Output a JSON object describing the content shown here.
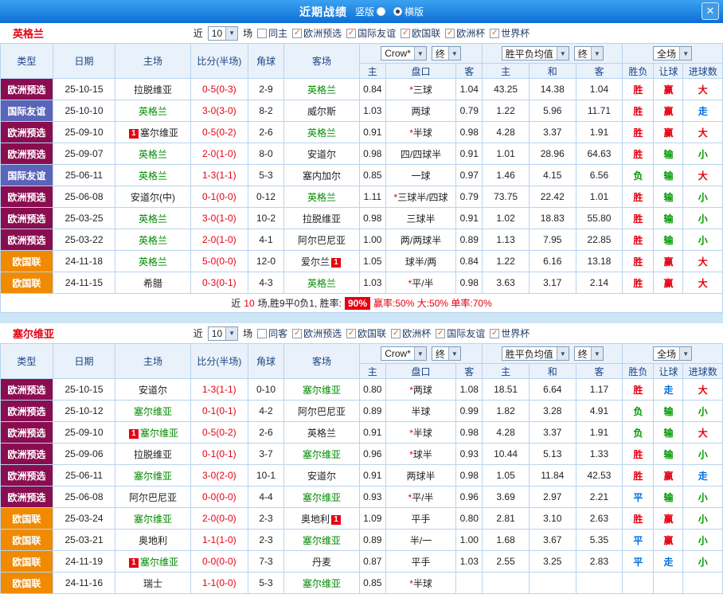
{
  "colors": {
    "type_欧洲预选": "#8a0d50",
    "type_国际友谊": "#5a64b8",
    "type_欧国联": "#f08a00",
    "result_win_red": "#e60012",
    "result_lose_green": "#009900",
    "result_push_blue": "#0070dd",
    "team_green": "#008a00",
    "score_red": "#e60012",
    "titlebar_blue": "#0d6ed6"
  },
  "titlebar": {
    "title": "近期战绩",
    "radios": [
      {
        "label": "竖版",
        "selected": false
      },
      {
        "label": "横版",
        "selected": true
      }
    ],
    "close_glyph": "✕"
  },
  "table_header": {
    "fixed_cols": [
      "类型",
      "日期",
      "主场",
      "比分(半场)",
      "角球",
      "客场"
    ],
    "groups": [
      {
        "dropdowns": [
          "Crow*",
          "终"
        ],
        "sub": [
          "主",
          "盘口",
          "客"
        ]
      },
      {
        "dropdowns": [
          "胜平负均值",
          "终"
        ],
        "sub": [
          "主",
          "和",
          "客"
        ]
      },
      {
        "dropdowns": [
          "全场"
        ],
        "sub": [
          "胜负",
          "让球",
          "进球数"
        ]
      }
    ]
  },
  "sections": [
    {
      "team": "英格兰",
      "filter": {
        "near_label": "近",
        "count": "10",
        "games_label": "场",
        "checkboxes": [
          {
            "label": "同主",
            "checked": false
          },
          {
            "label": "欧洲预选",
            "checked": true
          },
          {
            "label": "国际友谊",
            "checked": true
          },
          {
            "label": "欧国联",
            "checked": true
          },
          {
            "label": "欧洲杯",
            "checked": true
          },
          {
            "label": "世界杯",
            "checked": true
          }
        ]
      },
      "rows": [
        {
          "type": "欧洲预选",
          "date": "25-10-15",
          "home": "拉脱维亚",
          "home_green": false,
          "home_badge": "",
          "score": "0-5(0-3)",
          "corner": "2-9",
          "away": "英格兰",
          "away_green": true,
          "away_badge": "",
          "o1": "0.84",
          "handicap": "*三球",
          "o2": "1.04",
          "m1": "43.25",
          "m2": "14.38",
          "m3": "1.04",
          "r1": "胜",
          "r2": "赢",
          "r3": "大"
        },
        {
          "type": "国际友谊",
          "date": "25-10-10",
          "home": "英格兰",
          "home_green": true,
          "home_badge": "",
          "score": "3-0(3-0)",
          "corner": "8-2",
          "away": "威尔斯",
          "away_green": false,
          "away_badge": "",
          "o1": "1.03",
          "handicap": "两球",
          "o2": "0.79",
          "m1": "1.22",
          "m2": "5.96",
          "m3": "11.71",
          "r1": "胜",
          "r2": "赢",
          "r3": "走"
        },
        {
          "type": "欧洲预选",
          "date": "25-09-10",
          "home": "塞尔维亚",
          "home_green": false,
          "home_badge": "1",
          "score": "0-5(0-2)",
          "corner": "2-6",
          "away": "英格兰",
          "away_green": true,
          "away_badge": "",
          "o1": "0.91",
          "handicap": "*半球",
          "o2": "0.98",
          "m1": "4.28",
          "m2": "3.37",
          "m3": "1.91",
          "r1": "胜",
          "r2": "赢",
          "r3": "大"
        },
        {
          "type": "欧洲预选",
          "date": "25-09-07",
          "home": "英格兰",
          "home_green": true,
          "home_badge": "",
          "score": "2-0(1-0)",
          "corner": "8-0",
          "away": "安道尔",
          "away_green": false,
          "away_badge": "",
          "o1": "0.98",
          "handicap": "四/四球半",
          "o2": "0.91",
          "m1": "1.01",
          "m2": "28.96",
          "m3": "64.63",
          "r1": "胜",
          "r2": "输",
          "r3": "小"
        },
        {
          "type": "国际友谊",
          "date": "25-06-11",
          "home": "英格兰",
          "home_green": true,
          "home_badge": "",
          "score": "1-3(1-1)",
          "corner": "5-3",
          "away": "塞内加尔",
          "away_green": false,
          "away_badge": "",
          "o1": "0.85",
          "handicap": "一球",
          "o2": "0.97",
          "m1": "1.46",
          "m2": "4.15",
          "m3": "6.56",
          "r1": "负",
          "r2": "输",
          "r3": "大"
        },
        {
          "type": "欧洲预选",
          "date": "25-06-08",
          "home": "安道尔(中)",
          "home_green": false,
          "home_badge": "",
          "score": "0-1(0-0)",
          "corner": "0-12",
          "away": "英格兰",
          "away_green": true,
          "away_badge": "",
          "o1": "1.11",
          "handicap": "*三球半/四球",
          "o2": "0.79",
          "m1": "73.75",
          "m2": "22.42",
          "m3": "1.01",
          "r1": "胜",
          "r2": "输",
          "r3": "小"
        },
        {
          "type": "欧洲预选",
          "date": "25-03-25",
          "home": "英格兰",
          "home_green": true,
          "home_badge": "",
          "score": "3-0(1-0)",
          "corner": "10-2",
          "away": "拉脱维亚",
          "away_green": false,
          "away_badge": "",
          "o1": "0.98",
          "handicap": "三球半",
          "o2": "0.91",
          "m1": "1.02",
          "m2": "18.83",
          "m3": "55.80",
          "r1": "胜",
          "r2": "输",
          "r3": "小"
        },
        {
          "type": "欧洲预选",
          "date": "25-03-22",
          "home": "英格兰",
          "home_green": true,
          "home_badge": "",
          "score": "2-0(1-0)",
          "corner": "4-1",
          "away": "阿尔巴尼亚",
          "away_green": false,
          "away_badge": "",
          "o1": "1.00",
          "handicap": "两/两球半",
          "o2": "0.89",
          "m1": "1.13",
          "m2": "7.95",
          "m3": "22.85",
          "r1": "胜",
          "r2": "输",
          "r3": "小"
        },
        {
          "type": "欧国联",
          "date": "24-11-18",
          "home": "英格兰",
          "home_green": true,
          "home_badge": "",
          "score": "5-0(0-0)",
          "corner": "12-0",
          "away": "爱尔兰",
          "away_green": false,
          "away_badge": "1",
          "o1": "1.05",
          "handicap": "球半/两",
          "o2": "0.84",
          "m1": "1.22",
          "m2": "6.16",
          "m3": "13.18",
          "r1": "胜",
          "r2": "赢",
          "r3": "大"
        },
        {
          "type": "欧国联",
          "date": "24-11-15",
          "home": "希腊",
          "home_green": false,
          "home_badge": "",
          "score": "0-3(0-1)",
          "corner": "4-3",
          "away": "英格兰",
          "away_green": true,
          "away_badge": "",
          "o1": "1.03",
          "handicap": "*平/半",
          "o2": "0.98",
          "m1": "3.63",
          "m2": "3.17",
          "m3": "2.14",
          "r1": "胜",
          "r2": "赢",
          "r3": "大"
        }
      ],
      "summary": {
        "seg1": "近",
        "seg2": "10",
        "seg3": "场,胜9平0负1, 胜率:",
        "badge": "90%",
        "seg4": "赢率:50% 大:50% 单率:70%"
      }
    },
    {
      "team": "塞尔维亚",
      "filter": {
        "near_label": "近",
        "count": "10",
        "games_label": "场",
        "checkboxes": [
          {
            "label": "同客",
            "checked": false
          },
          {
            "label": "欧洲预选",
            "checked": true
          },
          {
            "label": "欧国联",
            "checked": true
          },
          {
            "label": "欧洲杯",
            "checked": true
          },
          {
            "label": "国际友谊",
            "checked": true
          },
          {
            "label": "世界杯",
            "checked": true
          }
        ]
      },
      "rows": [
        {
          "type": "欧洲预选",
          "date": "25-10-15",
          "home": "安道尔",
          "home_green": false,
          "home_badge": "",
          "score": "1-3(1-1)",
          "corner": "0-10",
          "away": "塞尔维亚",
          "away_green": true,
          "away_badge": "",
          "o1": "0.80",
          "handicap": "*两球",
          "o2": "1.08",
          "m1": "18.51",
          "m2": "6.64",
          "m3": "1.17",
          "r1": "胜",
          "r2": "走",
          "r3": "大"
        },
        {
          "type": "欧洲预选",
          "date": "25-10-12",
          "home": "塞尔维亚",
          "home_green": true,
          "home_badge": "",
          "score": "0-1(0-1)",
          "corner": "4-2",
          "away": "阿尔巴尼亚",
          "away_green": false,
          "away_badge": "",
          "o1": "0.89",
          "handicap": "半球",
          "o2": "0.99",
          "m1": "1.82",
          "m2": "3.28",
          "m3": "4.91",
          "r1": "负",
          "r2": "输",
          "r3": "小"
        },
        {
          "type": "欧洲预选",
          "date": "25-09-10",
          "home": "塞尔维亚",
          "home_green": true,
          "home_badge": "1",
          "score": "0-5(0-2)",
          "corner": "2-6",
          "away": "英格兰",
          "away_green": false,
          "away_badge": "",
          "o1": "0.91",
          "handicap": "*半球",
          "o2": "0.98",
          "m1": "4.28",
          "m2": "3.37",
          "m3": "1.91",
          "r1": "负",
          "r2": "输",
          "r3": "大"
        },
        {
          "type": "欧洲预选",
          "date": "25-09-06",
          "home": "拉脱维亚",
          "home_green": false,
          "home_badge": "",
          "score": "0-1(0-1)",
          "corner": "3-7",
          "away": "塞尔维亚",
          "away_green": true,
          "away_badge": "",
          "o1": "0.96",
          "handicap": "*球半",
          "o2": "0.93",
          "m1": "10.44",
          "m2": "5.13",
          "m3": "1.33",
          "r1": "胜",
          "r2": "输",
          "r3": "小"
        },
        {
          "type": "欧洲预选",
          "date": "25-06-11",
          "home": "塞尔维亚",
          "home_green": true,
          "home_badge": "",
          "score": "3-0(2-0)",
          "corner": "10-1",
          "away": "安道尔",
          "away_green": false,
          "away_badge": "",
          "o1": "0.91",
          "handicap": "两球半",
          "o2": "0.98",
          "m1": "1.05",
          "m2": "11.84",
          "m3": "42.53",
          "r1": "胜",
          "r2": "赢",
          "r3": "走"
        },
        {
          "type": "欧洲预选",
          "date": "25-06-08",
          "home": "阿尔巴尼亚",
          "home_green": false,
          "home_badge": "",
          "score": "0-0(0-0)",
          "corner": "4-4",
          "away": "塞尔维亚",
          "away_green": true,
          "away_badge": "",
          "o1": "0.93",
          "handicap": "*平/半",
          "o2": "0.96",
          "m1": "3.69",
          "m2": "2.97",
          "m3": "2.21",
          "r1": "平",
          "r2": "输",
          "r3": "小"
        },
        {
          "type": "欧国联",
          "date": "25-03-24",
          "home": "塞尔维亚",
          "home_green": true,
          "home_badge": "",
          "score": "2-0(0-0)",
          "corner": "2-3",
          "away": "奥地利",
          "away_green": false,
          "away_badge": "1",
          "o1": "1.09",
          "handicap": "平手",
          "o2": "0.80",
          "m1": "2.81",
          "m2": "3.10",
          "m3": "2.63",
          "r1": "胜",
          "r2": "赢",
          "r3": "小"
        },
        {
          "type": "欧国联",
          "date": "25-03-21",
          "home": "奥地利",
          "home_green": false,
          "home_badge": "",
          "score": "1-1(1-0)",
          "corner": "2-3",
          "away": "塞尔维亚",
          "away_green": true,
          "away_badge": "",
          "o1": "0.89",
          "handicap": "半/一",
          "o2": "1.00",
          "m1": "1.68",
          "m2": "3.67",
          "m3": "5.35",
          "r1": "平",
          "r2": "赢",
          "r3": "小"
        },
        {
          "type": "欧国联",
          "date": "24-11-19",
          "home": "塞尔维亚",
          "home_green": true,
          "home_badge": "1",
          "score": "0-0(0-0)",
          "corner": "7-3",
          "away": "丹麦",
          "away_green": false,
          "away_badge": "",
          "o1": "0.87",
          "handicap": "平手",
          "o2": "1.03",
          "m1": "2.55",
          "m2": "3.25",
          "m3": "2.83",
          "r1": "平",
          "r2": "走",
          "r3": "小"
        },
        {
          "type": "欧国联",
          "date": "24-11-16",
          "home": "瑞士",
          "home_green": false,
          "home_badge": "",
          "score": "1-1(0-0)",
          "corner": "5-3",
          "away": "塞尔维亚",
          "away_green": true,
          "away_badge": "",
          "o1": "0.85",
          "handicap": "*半球",
          "o2": "",
          "m1": "",
          "m2": "",
          "m3": "",
          "r1": "",
          "r2": "",
          "r3": ""
        }
      ],
      "summary": null
    }
  ]
}
